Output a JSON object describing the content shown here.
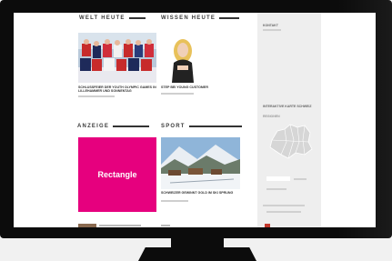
{
  "sections": {
    "welt_heute": "WELT HEUTE",
    "wissen_heute": "WISSEN HEUTE",
    "anzeige": "ANZEIGE",
    "sport": "SPORT"
  },
  "articles": {
    "a1_caption": "SCHLUSSFEIER DER YOUTH OLYMPIC GAMES IN LILLEHAMMER UND SONNENTAG",
    "a2_caption": "STEP BEI YOUNG CUSTOMER",
    "a3_caption": "SCHWEIZER GEWINNT GOLD IM SKI SPRUNG"
  },
  "ad": {
    "label": "Rectangle",
    "color": "#e6007e"
  },
  "sidebar": {
    "top_label": "KONTAKT",
    "map_title": "INTERAKTIVE KARTE SCHWEIZ",
    "map_sub": "REGIONEN"
  }
}
